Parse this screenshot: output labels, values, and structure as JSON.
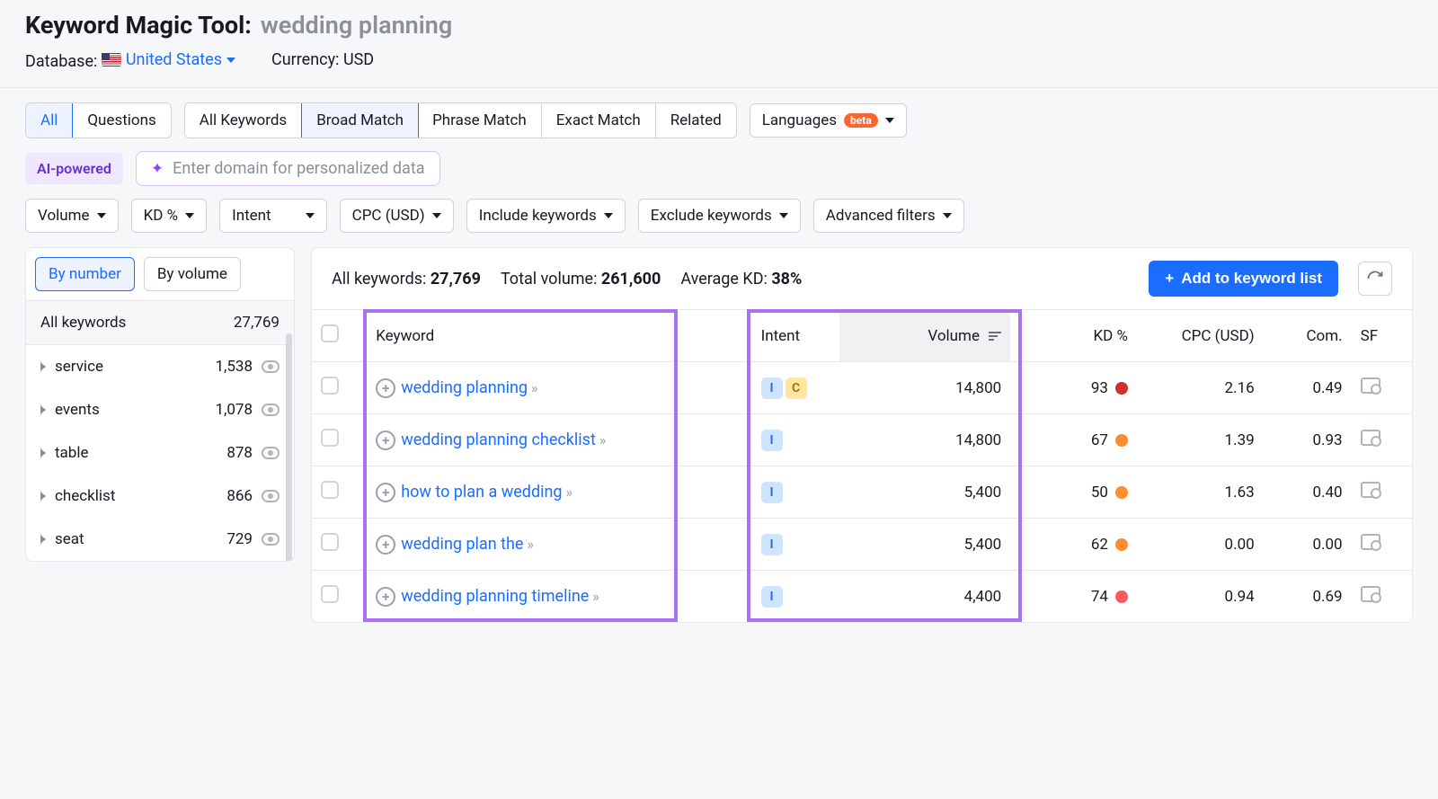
{
  "header": {
    "title_prefix": "Keyword Magic Tool:",
    "query": "wedding planning",
    "database_label": "Database:",
    "database_value": "United States",
    "currency_label": "Currency:",
    "currency_value": "USD"
  },
  "tabs1": {
    "all": "All",
    "questions": "Questions"
  },
  "tabs2": {
    "all_keywords": "All Keywords",
    "broad": "Broad Match",
    "phrase": "Phrase Match",
    "exact": "Exact Match",
    "related": "Related"
  },
  "lang_filter": {
    "label": "Languages",
    "badge": "beta"
  },
  "ai": {
    "chip": "AI-powered",
    "placeholder": "Enter domain for personalized data"
  },
  "filters": {
    "volume": "Volume",
    "kd": "KD %",
    "intent": "Intent",
    "cpc": "CPC (USD)",
    "include": "Include keywords",
    "exclude": "Exclude keywords",
    "advanced": "Advanced filters"
  },
  "sidebar": {
    "tab_number": "By number",
    "tab_volume": "By volume",
    "all_label": "All keywords",
    "all_count": "27,769",
    "items": [
      {
        "label": "service",
        "count": "1,538"
      },
      {
        "label": "events",
        "count": "1,078"
      },
      {
        "label": "table",
        "count": "878"
      },
      {
        "label": "checklist",
        "count": "866"
      },
      {
        "label": "seat",
        "count": "729"
      }
    ]
  },
  "summary": {
    "all_keywords_label": "All keywords:",
    "all_keywords_value": "27,769",
    "total_volume_label": "Total volume:",
    "total_volume_value": "261,600",
    "avg_kd_label": "Average KD:",
    "avg_kd_value": "38%",
    "add_button": "Add to keyword list"
  },
  "columns": {
    "keyword": "Keyword",
    "intent": "Intent",
    "volume": "Volume",
    "kd": "KD %",
    "cpc": "CPC (USD)",
    "com": "Com.",
    "sf": "SF"
  },
  "rows": [
    {
      "keyword": "wedding planning",
      "intents": [
        "I",
        "C"
      ],
      "volume": "14,800",
      "kd": "93",
      "kd_color": "kd-red",
      "cpc": "2.16",
      "com": "0.49"
    },
    {
      "keyword": "wedding planning checklist",
      "intents": [
        "I"
      ],
      "volume": "14,800",
      "kd": "67",
      "kd_color": "kd-orange",
      "cpc": "1.39",
      "com": "0.93"
    },
    {
      "keyword": "how to plan a wedding",
      "intents": [
        "I"
      ],
      "volume": "5,400",
      "kd": "50",
      "kd_color": "kd-orange",
      "cpc": "1.63",
      "com": "0.40"
    },
    {
      "keyword": "wedding plan the",
      "intents": [
        "I"
      ],
      "volume": "5,400",
      "kd": "62",
      "kd_color": "kd-orange",
      "cpc": "0.00",
      "com": "0.00"
    },
    {
      "keyword": "wedding planning timeline",
      "intents": [
        "I"
      ],
      "volume": "4,400",
      "kd": "74",
      "kd_color": "kd-lred",
      "cpc": "0.94",
      "com": "0.69"
    }
  ]
}
